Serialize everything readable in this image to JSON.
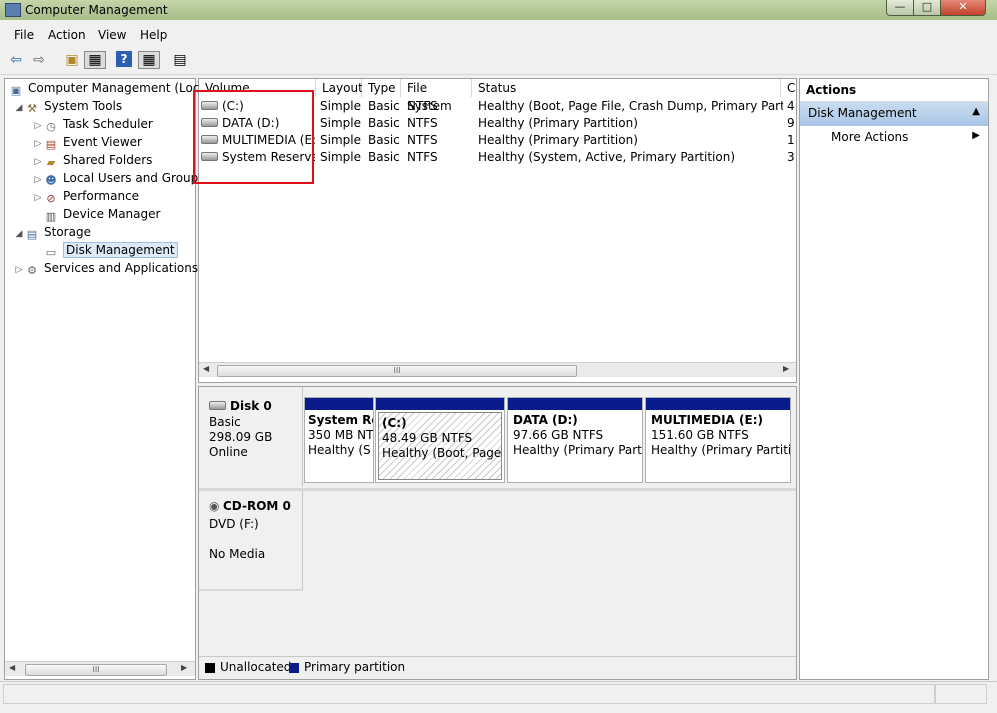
{
  "window": {
    "title": "Computer Management",
    "min": "—",
    "max": "□",
    "close": "✕"
  },
  "menu": [
    "File",
    "Action",
    "View",
    "Help"
  ],
  "toolbar": {
    "back": "⇦",
    "forward": "⇨",
    "up": "▣",
    "console": "▦",
    "help": "?",
    "pane": "▦",
    "properties": "▤"
  },
  "tree": {
    "root": "Computer Management (Local",
    "system_tools": "System Tools",
    "task_scheduler": "Task Scheduler",
    "event_viewer": "Event Viewer",
    "shared_folders": "Shared Folders",
    "local_users": "Local Users and Groups",
    "performance": "Performance",
    "device_manager": "Device Manager",
    "storage": "Storage",
    "disk_management": "Disk Management",
    "services": "Services and Applications",
    "scroll_thumb": "III"
  },
  "volume_table": {
    "headers": [
      "Volume",
      "Layout",
      "Type",
      "File System",
      "Status",
      "C"
    ],
    "rows": [
      [
        "(C:)",
        "Simple",
        "Basic",
        "NTFS",
        "Healthy (Boot, Page File, Crash Dump, Primary Partition)",
        "4"
      ],
      [
        "DATA (D:)",
        "Simple",
        "Basic",
        "NTFS",
        "Healthy (Primary Partition)",
        "9"
      ],
      [
        "MULTIMEDIA (E:)",
        "Simple",
        "Basic",
        "NTFS",
        "Healthy (Primary Partition)",
        "1"
      ],
      [
        "System Reserved",
        "Simple",
        "Basic",
        "NTFS",
        "Healthy (System, Active, Primary Partition)",
        "3"
      ]
    ],
    "scroll_thumb": "III"
  },
  "disk0": {
    "name": "Disk 0",
    "type": "Basic",
    "size": "298.09 GB",
    "state": "Online",
    "partitions": [
      {
        "name": "System Re",
        "size": "350 MB NT",
        "status": "Healthy (S"
      },
      {
        "name": "(C:)",
        "size": "48.49 GB NTFS",
        "status": "Healthy (Boot, Page F"
      },
      {
        "name": "DATA  (D:)",
        "size": "97.66 GB NTFS",
        "status": "Healthy (Primary Partiti"
      },
      {
        "name": "MULTIMEDIA  (E:)",
        "size": "151.60 GB NTFS",
        "status": "Healthy (Primary Partitio"
      }
    ]
  },
  "cdrom": {
    "name": "CD-ROM 0",
    "drive": "DVD (F:)",
    "media": "No Media"
  },
  "legend": {
    "unallocated": "Unallocated",
    "primary": "Primary partition",
    "unallocated_color": "#000000",
    "primary_color": "#0a1b8c"
  },
  "actions": {
    "title": "Actions",
    "section": "Disk Management",
    "more": "More Actions"
  },
  "colors": {
    "highlight_box": "#e0101a",
    "partition_bar": "#0a1b8c"
  }
}
